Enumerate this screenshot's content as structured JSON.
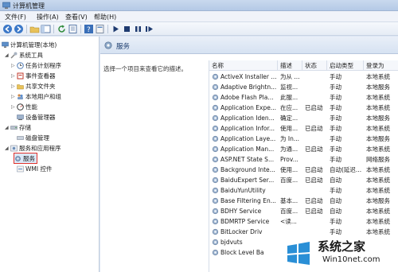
{
  "window": {
    "title": "计算机管理"
  },
  "menu": [
    "文件(F)",
    "操作(A)",
    "查看(V)",
    "帮助(H)"
  ],
  "tree": {
    "root": "计算机管理(本地)",
    "items": [
      {
        "label": "系统工具",
        "level": 1,
        "expanded": true
      },
      {
        "label": "任务计划程序",
        "level": 2
      },
      {
        "label": "事件查看器",
        "level": 2
      },
      {
        "label": "共享文件夹",
        "level": 2
      },
      {
        "label": "本地用户和组",
        "level": 2
      },
      {
        "label": "性能",
        "level": 2
      },
      {
        "label": "设备管理器",
        "level": 2
      },
      {
        "label": "存储",
        "level": 1,
        "expanded": true
      },
      {
        "label": "磁盘管理",
        "level": 2
      },
      {
        "label": "服务和应用程序",
        "level": 1,
        "expanded": true
      },
      {
        "label": "服务",
        "level": 2,
        "selected": true
      },
      {
        "label": "WMI 控件",
        "level": 2
      }
    ]
  },
  "pane": {
    "title": "服务",
    "description": "选择一个项目来查看它的描述。",
    "columns": [
      "名称",
      "描述",
      "状态",
      "启动类型",
      "登录为"
    ],
    "rows": [
      [
        "ActiveX Installer ...",
        "为从 ...",
        "",
        "手动",
        "本地系统"
      ],
      [
        "Adaptive Brightn...",
        "监视...",
        "",
        "手动",
        "本地服务"
      ],
      [
        "Adobe Flash Pla...",
        "此服...",
        "",
        "手动",
        "本地系统"
      ],
      [
        "Application Expe...",
        "在应...",
        "已启动",
        "手动",
        "本地系统"
      ],
      [
        "Application Iden...",
        "确定...",
        "",
        "手动",
        "本地服务"
      ],
      [
        "Application Infor...",
        "使用...",
        "已启动",
        "手动",
        "本地系统"
      ],
      [
        "Application Laye...",
        "为 In...",
        "",
        "手动",
        "本地服务"
      ],
      [
        "Application Man...",
        "为通...",
        "已启动",
        "手动",
        "本地系统"
      ],
      [
        "ASP.NET State S...",
        "Prov...",
        "",
        "手动",
        "网络服务"
      ],
      [
        "Background Inte...",
        "使用...",
        "已启动",
        "自动(延迟...",
        "本地系统"
      ],
      [
        "BaiduExpert Ser...",
        "百度...",
        "已启动",
        "自动",
        "本地系统"
      ],
      [
        "BaiduYunUtility",
        "",
        "",
        "手动",
        "本地系统"
      ],
      [
        "Base Filtering En...",
        "基本...",
        "已启动",
        "自动",
        "本地服务"
      ],
      [
        "BDHY Service",
        "百度...",
        "已启动",
        "自动",
        "本地系统"
      ],
      [
        "BDMRTP Service",
        "<读...",
        "",
        "手动",
        "本地系统"
      ],
      [
        "BitLocker Driv",
        "",
        "",
        "手动",
        "本地系统"
      ],
      [
        "bjdvuts",
        "",
        "",
        "",
        ""
      ],
      [
        "Block Level Ba",
        "",
        "",
        "",
        ""
      ]
    ]
  },
  "watermark": {
    "brand": "系统之家",
    "url": "Win10net.com"
  },
  "colors": {
    "selection_outline": "#e0322c",
    "header_text": "#1c3d6e"
  }
}
